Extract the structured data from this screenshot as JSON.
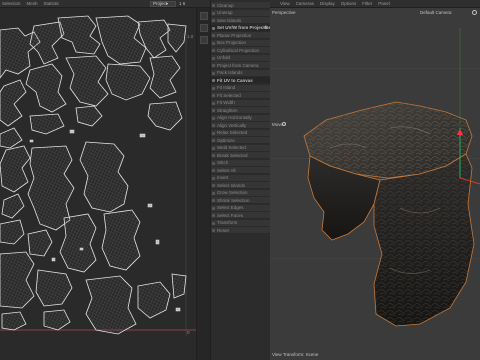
{
  "uv_editor": {
    "menu": [
      "Selection",
      "Mesh",
      "Statistic"
    ],
    "dropdown_value": "Project",
    "dropdown_extra": "1 6",
    "coord_top": "1.0",
    "coord_bottom": "0"
  },
  "tool_panel": {
    "items": [
      {
        "label": "Cleanup",
        "kind": "item"
      },
      {
        "label": "Unwrap",
        "kind": "item"
      },
      {
        "label": "Sew Islands",
        "kind": "item"
      },
      {
        "label": "Set UV/W from Projection",
        "kind": "header"
      },
      {
        "label": "Planar Projection",
        "kind": "item"
      },
      {
        "label": "Box Projection",
        "kind": "item"
      },
      {
        "label": "Cylindrical Projection",
        "kind": "item"
      },
      {
        "label": "Unfold",
        "kind": "item"
      },
      {
        "label": "Project from Camera",
        "kind": "item"
      },
      {
        "label": "Pack Islands",
        "kind": "item"
      },
      {
        "label": "Fit UV to Canvas",
        "kind": "header"
      },
      {
        "label": "Fit Island",
        "kind": "item"
      },
      {
        "label": "Fit Selected",
        "kind": "item"
      },
      {
        "label": "Fit Width",
        "kind": "item"
      },
      {
        "label": "Straighten",
        "kind": "item"
      },
      {
        "label": "Align Horizontally",
        "kind": "item"
      },
      {
        "label": "Align Vertically",
        "kind": "item"
      },
      {
        "label": "Relax Selected",
        "kind": "item"
      },
      {
        "label": "Optimize",
        "kind": "item"
      },
      {
        "label": "Weld Selected",
        "kind": "item"
      },
      {
        "label": "Break Selected",
        "kind": "item"
      },
      {
        "label": "Stitch",
        "kind": "item"
      },
      {
        "label": "Select All",
        "kind": "item"
      },
      {
        "label": "Invert",
        "kind": "item"
      },
      {
        "label": "Select Islands",
        "kind": "item"
      },
      {
        "label": "Grow Selection",
        "kind": "item"
      },
      {
        "label": "Shrink Selection",
        "kind": "item"
      },
      {
        "label": "Select Edges",
        "kind": "item"
      },
      {
        "label": "Select Faces",
        "kind": "item"
      },
      {
        "label": "Transform",
        "kind": "item"
      },
      {
        "label": "Reset",
        "kind": "item"
      }
    ]
  },
  "viewport": {
    "menu": [
      "View",
      "Cameras",
      "Display",
      "Options",
      "Filter",
      "Panel"
    ],
    "projection_label": "Perspective",
    "camera_label": "Default Camera",
    "side_label": "Move",
    "footer": "View Transform: Scene"
  },
  "colors": {
    "uv_wire": "#e6e6e6",
    "island_fill": "#8e8e8e",
    "canvas_edge": "#a54a55",
    "gizmo_green": "#1ed760",
    "gizmo_red": "#ff3344",
    "rock_outline": "#c87a3a"
  }
}
